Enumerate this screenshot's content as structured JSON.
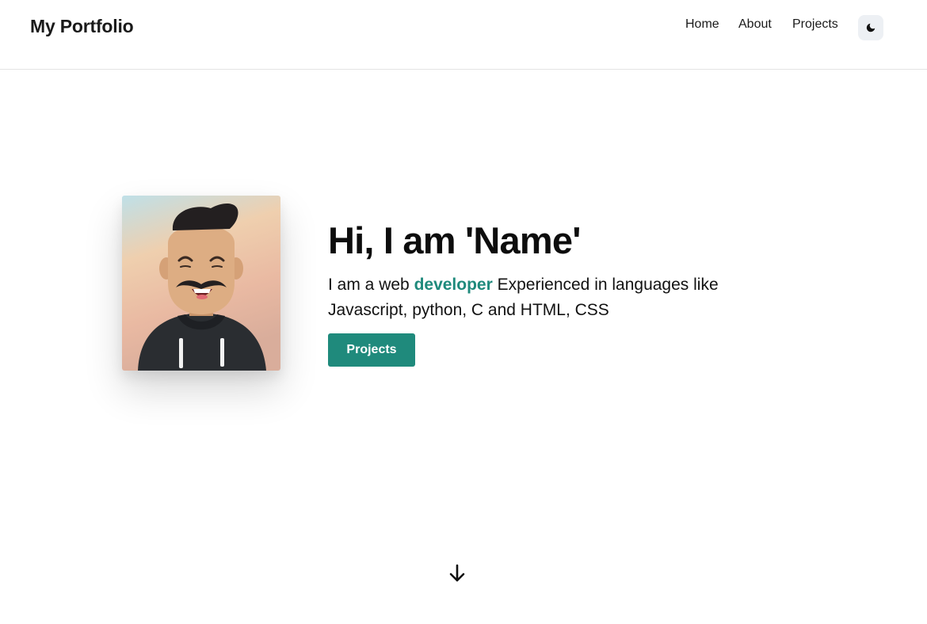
{
  "navbar": {
    "brand": "My Portfolio",
    "links": [
      "Home",
      "About",
      "Projects"
    ],
    "theme_toggle_icon": "moon-icon"
  },
  "hero": {
    "title": "Hi, I am 'Name'",
    "sub_pre": "I am a web ",
    "sub_accent": "developer",
    "sub_post": " Experienced in languages like Javascript, python, C and HTML, CSS",
    "cta_label": "Projects",
    "avatar_icon": "avatar"
  },
  "scroll_icon": "arrow-down-icon",
  "colors": {
    "accent": "#1f8a7c",
    "toggle_bg": "#edf0f4",
    "text": "#111111"
  }
}
